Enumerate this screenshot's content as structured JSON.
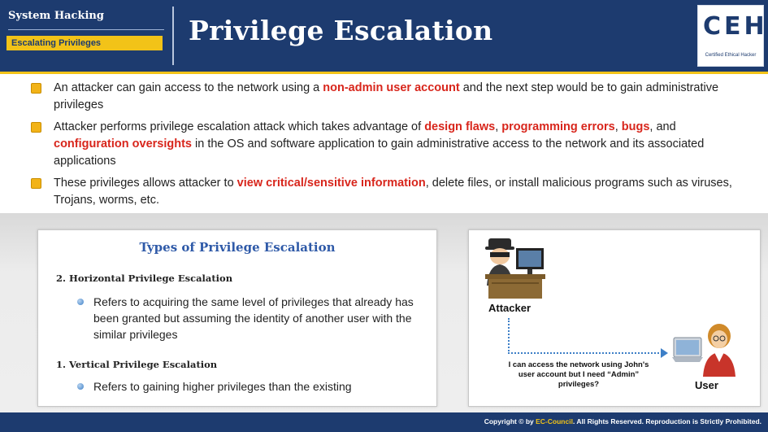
{
  "header": {
    "section": "System Hacking",
    "subsection": "Escalating Privileges",
    "title": "Privilege Escalation",
    "logo": {
      "letters": "CEH",
      "tagline": "Certified Ethical Hacker"
    }
  },
  "bullets": [
    {
      "parts": [
        {
          "text": "An attacker can gain access to the network using a ",
          "highlight": false
        },
        {
          "text": "non-admin user account",
          "highlight": true
        },
        {
          "text": " and the next step would be to gain administrative privileges",
          "highlight": false
        }
      ]
    },
    {
      "parts": [
        {
          "text": "Attacker performs privilege escalation attack which takes advantage of ",
          "highlight": false
        },
        {
          "text": "design flaws",
          "highlight": true
        },
        {
          "text": ", ",
          "highlight": false
        },
        {
          "text": "programming errors",
          "highlight": true
        },
        {
          "text": ", ",
          "highlight": false
        },
        {
          "text": "bugs",
          "highlight": true
        },
        {
          "text": ", and ",
          "highlight": false
        },
        {
          "text": "configuration oversights",
          "highlight": true
        },
        {
          "text": " in the OS and software application to gain administrative access to the network and its associated applications",
          "highlight": false
        }
      ]
    },
    {
      "parts": [
        {
          "text": "These privileges allows attacker to ",
          "highlight": false
        },
        {
          "text": "view critical/sensitive information",
          "highlight": true
        },
        {
          "text": ", delete files, or install malicious programs such as viruses, Trojans, worms, etc.",
          "highlight": false
        }
      ]
    }
  ],
  "types": {
    "title": "Types of Privilege Escalation",
    "items": [
      {
        "heading": "2.  Horizontal Privilege Escalation",
        "desc": "Refers to acquiring the same level of privileges that already has been granted but assuming the identity of another user with the similar privileges"
      },
      {
        "heading": "1.  Vertical Privilege Escalation",
        "desc": "Refers to gaining higher privileges than the existing"
      }
    ]
  },
  "diagram": {
    "attacker_label": "Attacker",
    "user_label": "User",
    "speech": "I can access the network using John's user account but I need “Admin” privileges?"
  },
  "footer": {
    "prefix": "Copyright © by ",
    "brand": "EC-Council",
    "suffix": ". All Rights Reserved. Reproduction is Strictly Prohibited."
  },
  "colors": {
    "header_bg": "#1d3b6f",
    "accent_gold": "#f2c318",
    "highlight_red": "#d8261c",
    "panel_title_blue": "#2f5aa8"
  }
}
